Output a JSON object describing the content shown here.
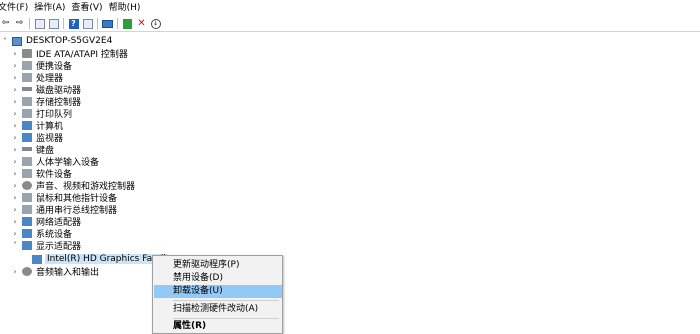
{
  "menubar": {
    "items": [
      "文件(F)",
      "操作(A)",
      "查看(V)",
      "帮助(H)"
    ]
  },
  "toolbar": {
    "icons": [
      "back-arrow-icon",
      "forward-arrow-icon",
      "properties-icon",
      "list-icon",
      "help-icon",
      "list-view-icon",
      "monitor-icon",
      "update-driver-icon",
      "uninstall-icon",
      "download-icon"
    ]
  },
  "tree": {
    "root": "DESKTOP-S5GV2E4",
    "categories": [
      "IDE ATA/ATAPI 控制器",
      "便携设备",
      "处理器",
      "磁盘驱动器",
      "存储控制器",
      "打印队列",
      "计算机",
      "监视器",
      "键盘",
      "人体学输入设备",
      "软件设备",
      "声音、视频和游戏控制器",
      "鼠标和其他指针设备",
      "通用串行总线控制器",
      "网络适配器",
      "系统设备",
      "显示适配器"
    ],
    "child": "Intel(R) HD Graphics Famil",
    "after": "音频输入和输出"
  },
  "context_menu": {
    "items": [
      "更新驱动程序(P)",
      "禁用设备(D)",
      "卸载设备(U)",
      "扫描检测硬件改动(A)",
      "属性(R)"
    ]
  },
  "colors": {
    "selection": "#cce4f7",
    "menu_highlight": "#91c9f7"
  }
}
